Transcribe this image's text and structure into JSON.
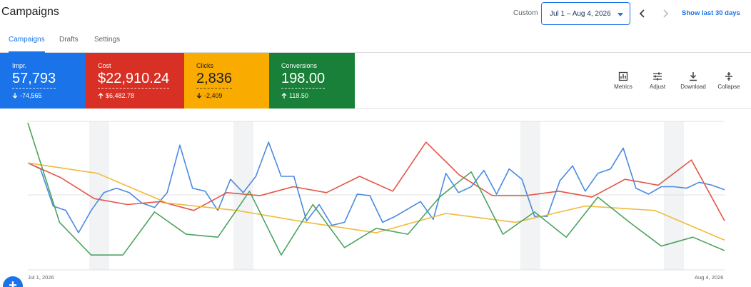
{
  "header": {
    "title": "Campaigns",
    "custom_label": "Custom",
    "date_range": "Jul 1 – Aug 4, 2026",
    "show_last": "Show last 30 days"
  },
  "tabs": [
    {
      "label": "Campaigns",
      "active": true
    },
    {
      "label": "Drafts",
      "active": false
    },
    {
      "label": "Settings",
      "active": false
    }
  ],
  "scorecards": {
    "impr": {
      "label": "Impr.",
      "value": "57,793",
      "delta": "-74,565",
      "direction": "down",
      "color": "#1a73e8"
    },
    "cost": {
      "label": "Cost",
      "value": "$22,910.24",
      "delta": "$6,482.78",
      "direction": "up",
      "color": "#d93025"
    },
    "clicks": {
      "label": "Clicks",
      "value": "2,836",
      "delta": "-2,409",
      "direction": "down",
      "color": "#f9ab00"
    },
    "conversions": {
      "label": "Conversions",
      "value": "198.00",
      "delta": "118.50",
      "direction": "up",
      "color": "#188038"
    }
  },
  "toolbar": {
    "metrics": "Metrics",
    "adjust": "Adjust",
    "download": "Download",
    "collapse": "Collapse"
  },
  "chart_data": {
    "type": "line",
    "x_start_label": "Jul 1, 2026",
    "x_end_label": "Aug 4, 2026",
    "grid": true,
    "weekend_bands": true,
    "x_days": 35,
    "series": [
      {
        "metric": "impr",
        "color": "#4a8ae0",
        "values": [
          28,
          32,
          57,
          60,
          75,
          60,
          48,
          45,
          48,
          55,
          58,
          48,
          16,
          45,
          47,
          60,
          39,
          48,
          37,
          14,
          37,
          37,
          67,
          56,
          70,
          68,
          49,
          50,
          68,
          64,
          59,
          54,
          66,
          35,
          48,
          44,
          33,
          49,
          32,
          39,
          64,
          64,
          40,
          30,
          47,
          35,
          32,
          18,
          45,
          49,
          44,
          44,
          45,
          41,
          43,
          46
        ]
      },
      {
        "metric": "cost",
        "color": "#e25548",
        "values": [
          28,
          38,
          52,
          56,
          54,
          60,
          48,
          50,
          44,
          48,
          37,
          47,
          14,
          36,
          50,
          50,
          47,
          51,
          39,
          43,
          26,
          67
        ]
      },
      {
        "metric": "clicks",
        "color": "#f0bb3a",
        "values": [
          28,
          35,
          55,
          60,
          68,
          75,
          62,
          68,
          57,
          60,
          80
        ]
      },
      {
        "metric": "conversions",
        "color": "#4ca35f",
        "values": [
          1,
          68,
          90,
          90,
          61,
          76,
          78,
          47,
          90,
          56,
          85,
          72,
          76,
          51,
          34,
          76,
          61,
          78,
          51,
          68,
          84,
          78,
          87
        ]
      }
    ]
  }
}
